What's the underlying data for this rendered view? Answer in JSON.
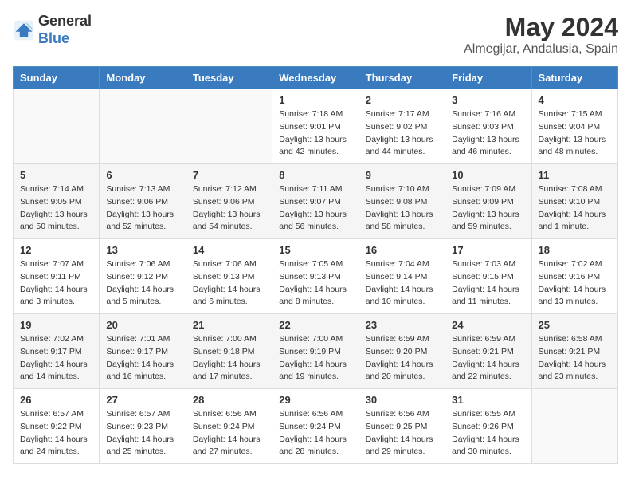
{
  "logo": {
    "line1": "General",
    "line2": "Blue"
  },
  "title": "May 2024",
  "location": "Almegijar, Andalusia, Spain",
  "weekdays": [
    "Sunday",
    "Monday",
    "Tuesday",
    "Wednesday",
    "Thursday",
    "Friday",
    "Saturday"
  ],
  "weeks": [
    [
      {
        "day": "",
        "info": ""
      },
      {
        "day": "",
        "info": ""
      },
      {
        "day": "",
        "info": ""
      },
      {
        "day": "1",
        "info": "Sunrise: 7:18 AM\nSunset: 9:01 PM\nDaylight: 13 hours\nand 42 minutes."
      },
      {
        "day": "2",
        "info": "Sunrise: 7:17 AM\nSunset: 9:02 PM\nDaylight: 13 hours\nand 44 minutes."
      },
      {
        "day": "3",
        "info": "Sunrise: 7:16 AM\nSunset: 9:03 PM\nDaylight: 13 hours\nand 46 minutes."
      },
      {
        "day": "4",
        "info": "Sunrise: 7:15 AM\nSunset: 9:04 PM\nDaylight: 13 hours\nand 48 minutes."
      }
    ],
    [
      {
        "day": "5",
        "info": "Sunrise: 7:14 AM\nSunset: 9:05 PM\nDaylight: 13 hours\nand 50 minutes."
      },
      {
        "day": "6",
        "info": "Sunrise: 7:13 AM\nSunset: 9:06 PM\nDaylight: 13 hours\nand 52 minutes."
      },
      {
        "day": "7",
        "info": "Sunrise: 7:12 AM\nSunset: 9:06 PM\nDaylight: 13 hours\nand 54 minutes."
      },
      {
        "day": "8",
        "info": "Sunrise: 7:11 AM\nSunset: 9:07 PM\nDaylight: 13 hours\nand 56 minutes."
      },
      {
        "day": "9",
        "info": "Sunrise: 7:10 AM\nSunset: 9:08 PM\nDaylight: 13 hours\nand 58 minutes."
      },
      {
        "day": "10",
        "info": "Sunrise: 7:09 AM\nSunset: 9:09 PM\nDaylight: 13 hours\nand 59 minutes."
      },
      {
        "day": "11",
        "info": "Sunrise: 7:08 AM\nSunset: 9:10 PM\nDaylight: 14 hours\nand 1 minute."
      }
    ],
    [
      {
        "day": "12",
        "info": "Sunrise: 7:07 AM\nSunset: 9:11 PM\nDaylight: 14 hours\nand 3 minutes."
      },
      {
        "day": "13",
        "info": "Sunrise: 7:06 AM\nSunset: 9:12 PM\nDaylight: 14 hours\nand 5 minutes."
      },
      {
        "day": "14",
        "info": "Sunrise: 7:06 AM\nSunset: 9:13 PM\nDaylight: 14 hours\nand 6 minutes."
      },
      {
        "day": "15",
        "info": "Sunrise: 7:05 AM\nSunset: 9:13 PM\nDaylight: 14 hours\nand 8 minutes."
      },
      {
        "day": "16",
        "info": "Sunrise: 7:04 AM\nSunset: 9:14 PM\nDaylight: 14 hours\nand 10 minutes."
      },
      {
        "day": "17",
        "info": "Sunrise: 7:03 AM\nSunset: 9:15 PM\nDaylight: 14 hours\nand 11 minutes."
      },
      {
        "day": "18",
        "info": "Sunrise: 7:02 AM\nSunset: 9:16 PM\nDaylight: 14 hours\nand 13 minutes."
      }
    ],
    [
      {
        "day": "19",
        "info": "Sunrise: 7:02 AM\nSunset: 9:17 PM\nDaylight: 14 hours\nand 14 minutes."
      },
      {
        "day": "20",
        "info": "Sunrise: 7:01 AM\nSunset: 9:17 PM\nDaylight: 14 hours\nand 16 minutes."
      },
      {
        "day": "21",
        "info": "Sunrise: 7:00 AM\nSunset: 9:18 PM\nDaylight: 14 hours\nand 17 minutes."
      },
      {
        "day": "22",
        "info": "Sunrise: 7:00 AM\nSunset: 9:19 PM\nDaylight: 14 hours\nand 19 minutes."
      },
      {
        "day": "23",
        "info": "Sunrise: 6:59 AM\nSunset: 9:20 PM\nDaylight: 14 hours\nand 20 minutes."
      },
      {
        "day": "24",
        "info": "Sunrise: 6:59 AM\nSunset: 9:21 PM\nDaylight: 14 hours\nand 22 minutes."
      },
      {
        "day": "25",
        "info": "Sunrise: 6:58 AM\nSunset: 9:21 PM\nDaylight: 14 hours\nand 23 minutes."
      }
    ],
    [
      {
        "day": "26",
        "info": "Sunrise: 6:57 AM\nSunset: 9:22 PM\nDaylight: 14 hours\nand 24 minutes."
      },
      {
        "day": "27",
        "info": "Sunrise: 6:57 AM\nSunset: 9:23 PM\nDaylight: 14 hours\nand 25 minutes."
      },
      {
        "day": "28",
        "info": "Sunrise: 6:56 AM\nSunset: 9:24 PM\nDaylight: 14 hours\nand 27 minutes."
      },
      {
        "day": "29",
        "info": "Sunrise: 6:56 AM\nSunset: 9:24 PM\nDaylight: 14 hours\nand 28 minutes."
      },
      {
        "day": "30",
        "info": "Sunrise: 6:56 AM\nSunset: 9:25 PM\nDaylight: 14 hours\nand 29 minutes."
      },
      {
        "day": "31",
        "info": "Sunrise: 6:55 AM\nSunset: 9:26 PM\nDaylight: 14 hours\nand 30 minutes."
      },
      {
        "day": "",
        "info": ""
      }
    ]
  ]
}
